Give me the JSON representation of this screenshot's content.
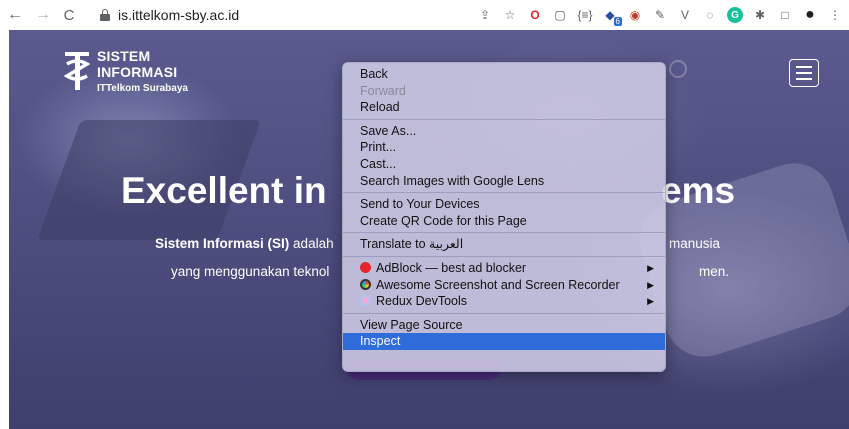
{
  "browser": {
    "url": "is.ittelkom-sby.ac.id",
    "back_icon": "←",
    "forward_icon": "→",
    "reload_icon": "C",
    "extensions": [
      {
        "name": "share-icon",
        "glyph": "⇪"
      },
      {
        "name": "bookmark-star-icon",
        "glyph": "☆"
      },
      {
        "name": "opera-icon",
        "glyph": "O"
      },
      {
        "name": "blank-extension-icon",
        "glyph": "▢"
      },
      {
        "name": "json-viewer-icon",
        "glyph": "{≡}"
      },
      {
        "name": "extension-badge-icon",
        "glyph": "◆"
      },
      {
        "name": "camera-icon",
        "glyph": "◉"
      },
      {
        "name": "eyedropper-icon",
        "glyph": "✎"
      },
      {
        "name": "vue-devtools-icon",
        "glyph": "V"
      },
      {
        "name": "redux-icon",
        "glyph": "◌"
      },
      {
        "name": "grammarly-icon",
        "glyph": "G"
      },
      {
        "name": "puzzle-extensions-icon",
        "glyph": "✱"
      },
      {
        "name": "sidebar-icon",
        "glyph": "□"
      },
      {
        "name": "profile-avatar-icon",
        "glyph": "●"
      },
      {
        "name": "kebab-menu-icon",
        "glyph": "⋮"
      }
    ],
    "extension_badge": "6"
  },
  "site": {
    "logo_line1": "SISTEM",
    "logo_line2": "INFORMASI",
    "logo_line3": "ITTelkom Surabaya",
    "hero_title_left": "Excellent in",
    "hero_title_right": "ems",
    "hero_line1_bold": "Sistem Informasi (SI)",
    "hero_line1_rest": " adalah",
    "hero_line1_right": "manusia",
    "hero_line2_left": "yang menggunakan teknol",
    "hero_line2_right": "men."
  },
  "context_menu": {
    "groups": [
      [
        {
          "label": "Back",
          "disabled": false
        },
        {
          "label": "Forward",
          "disabled": true
        },
        {
          "label": "Reload",
          "disabled": false
        }
      ],
      [
        {
          "label": "Save As...",
          "disabled": false
        },
        {
          "label": "Print...",
          "disabled": false
        },
        {
          "label": "Cast...",
          "disabled": false
        },
        {
          "label": "Search Images with Google Lens",
          "disabled": false
        }
      ],
      [
        {
          "label": "Send to Your Devices",
          "disabled": false
        },
        {
          "label": "Create QR Code for this Page",
          "disabled": false
        }
      ],
      [
        {
          "label": "Translate to العربية",
          "disabled": false
        }
      ],
      [
        {
          "label": "AdBlock — best ad blocker",
          "icon": "adblock-icon",
          "submenu": true
        },
        {
          "label": "Awesome Screenshot and Screen Recorder",
          "icon": "awesome-screenshot-icon",
          "submenu": true
        },
        {
          "label": "Redux DevTools",
          "icon": "redux-devtools-icon",
          "submenu": true
        }
      ],
      [
        {
          "label": "View Page Source",
          "disabled": false
        },
        {
          "label": "Inspect",
          "disabled": false,
          "selected": true
        }
      ]
    ],
    "submenu_arrow": "▶"
  }
}
